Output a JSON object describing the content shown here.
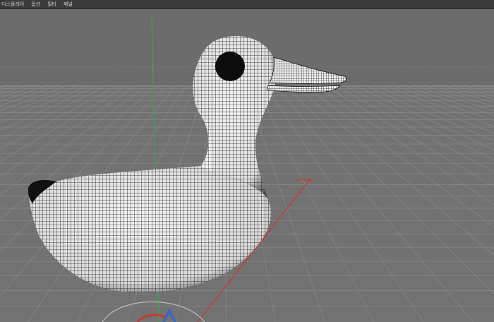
{
  "menu": {
    "items": [
      {
        "label": "디스플레이"
      },
      {
        "label": "옵션"
      },
      {
        "label": "필터"
      },
      {
        "label": "패널"
      }
    ]
  },
  "viewport": {
    "background_color": "#727272",
    "grid_color": "#8a8a8a",
    "model_color": "#f4f4f4",
    "wire_color": "#111111",
    "axis_colors": {
      "y": "#3fa34d",
      "x": "#c9392e",
      "z": "#2f67d6"
    }
  }
}
